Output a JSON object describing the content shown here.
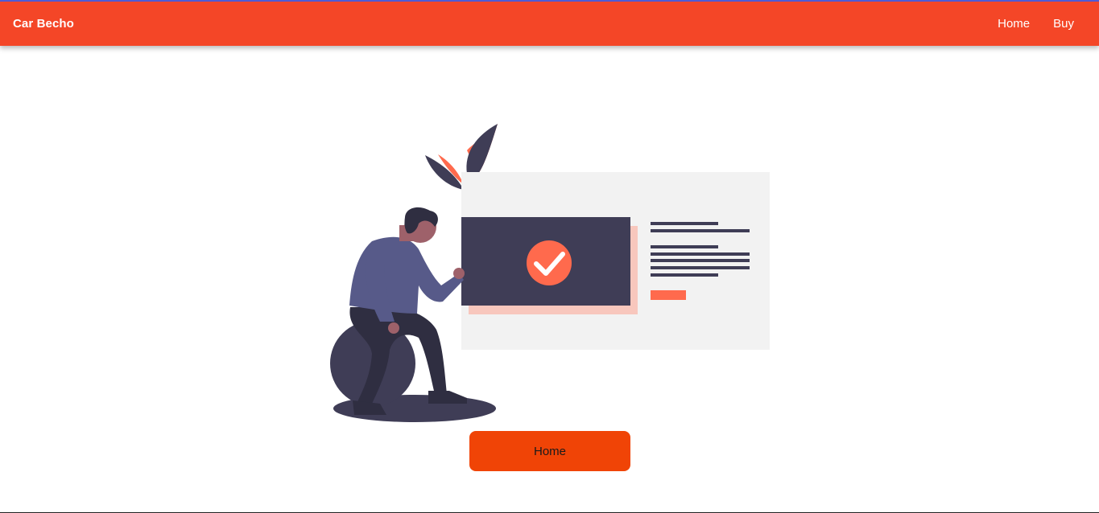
{
  "navbar": {
    "brand": "Car Becho",
    "links": [
      {
        "label": "Home"
      },
      {
        "label": "Buy"
      }
    ],
    "background_color": "#f44627"
  },
  "main": {
    "illustration_icon": "success-check-illustration",
    "accent_color": "#ff6a4d",
    "button_label": "Home",
    "button_color": "#f04406"
  }
}
